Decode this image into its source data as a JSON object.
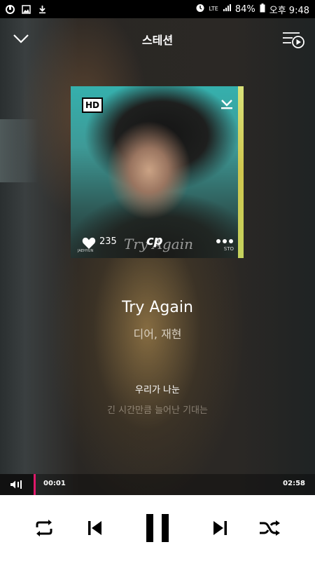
{
  "status_bar": {
    "network": "LTE",
    "battery": "84%",
    "time": "오후 9:48"
  },
  "header": {
    "title": "스테션"
  },
  "album": {
    "quality_badge": "HD",
    "likes": "235",
    "logo_text": "cp",
    "cover_script": "Try Again",
    "cover_artist": "JAEHYUN",
    "cover_label": "STO"
  },
  "song": {
    "title": "Try Again",
    "artist": "디어, 재현"
  },
  "lyrics": {
    "current": "우리가 나눈",
    "next": "긴 시간만큼 늘어난 기대는"
  },
  "playback": {
    "current_time": "00:01",
    "total_time": "02:58",
    "progress_fraction": 0.006
  },
  "colors": {
    "accent": "#e0186a"
  }
}
